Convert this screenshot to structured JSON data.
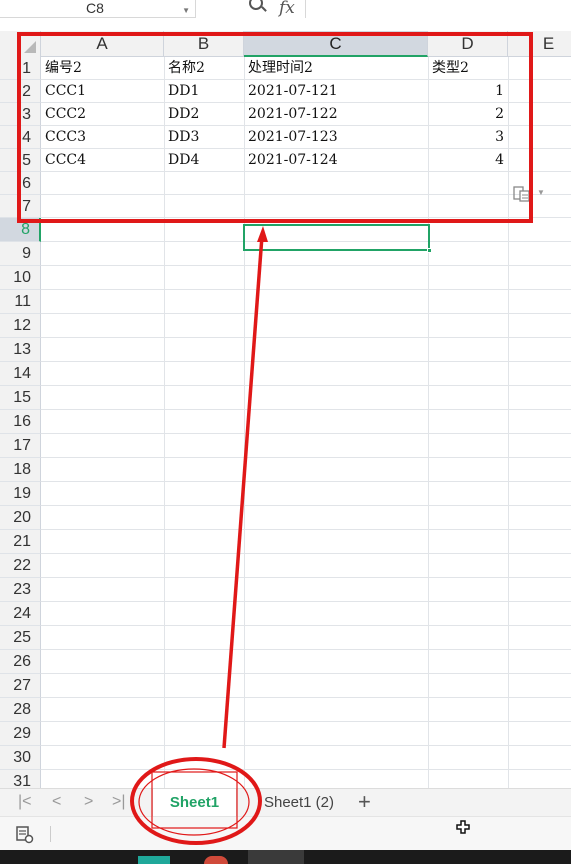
{
  "formula_bar": {
    "name_box": "C8",
    "zoom_icon": "zoom-icon",
    "fx_label": "fx",
    "formula_value": ""
  },
  "columns": [
    "A",
    "B",
    "C",
    "D",
    "E"
  ],
  "selected_column": "C",
  "selected_row": "8",
  "rows": [
    {
      "num": "1",
      "a": "编号2",
      "b": "名称2",
      "c": "处理时间2",
      "d": ""
    },
    {
      "num": "2",
      "a": "CCC1",
      "b": "DD1",
      "c": "2021-07-121",
      "d": "1"
    },
    {
      "num": "3",
      "a": "CCC2",
      "b": "DD2",
      "c": "2021-07-122",
      "d": "2"
    },
    {
      "num": "4",
      "a": "CCC3",
      "b": "DD3",
      "c": "2021-07-123",
      "d": "3"
    },
    {
      "num": "5",
      "a": "CCC4",
      "b": "DD4",
      "c": "2021-07-124",
      "d": "4"
    },
    {
      "num": "6",
      "a": "",
      "b": "",
      "c": "",
      "d": ""
    },
    {
      "num": "7",
      "a": "",
      "b": "",
      "c": "",
      "d": ""
    },
    {
      "num": "8"
    },
    {
      "num": "9"
    },
    {
      "num": "10"
    },
    {
      "num": "11"
    },
    {
      "num": "12"
    },
    {
      "num": "13"
    },
    {
      "num": "14"
    },
    {
      "num": "15"
    },
    {
      "num": "16"
    },
    {
      "num": "17"
    },
    {
      "num": "18"
    },
    {
      "num": "19"
    },
    {
      "num": "20"
    },
    {
      "num": "21"
    },
    {
      "num": "22"
    },
    {
      "num": "23"
    },
    {
      "num": "24"
    },
    {
      "num": "25"
    },
    {
      "num": "26"
    },
    {
      "num": "27"
    },
    {
      "num": "28"
    },
    {
      "num": "29"
    },
    {
      "num": "30"
    },
    {
      "num": "31"
    }
  ],
  "d1_header": "类型2",
  "sheet_tabs": {
    "active": "Sheet1",
    "other": "Sheet1 (2)",
    "add_icon": "plus-icon",
    "nav_icons": [
      "first-sheet-icon",
      "prev-sheet-icon",
      "next-sheet-icon",
      "last-sheet-icon"
    ]
  },
  "status_bar": {
    "macro_icon": "macro-record-icon",
    "cursor_icon": "move-cursor-icon"
  },
  "colors": {
    "accent_green": "#21a366",
    "annotation_red": "#e01818",
    "header_bg": "#f2f2f2",
    "selected_header_bg": "#d2d8e0"
  }
}
